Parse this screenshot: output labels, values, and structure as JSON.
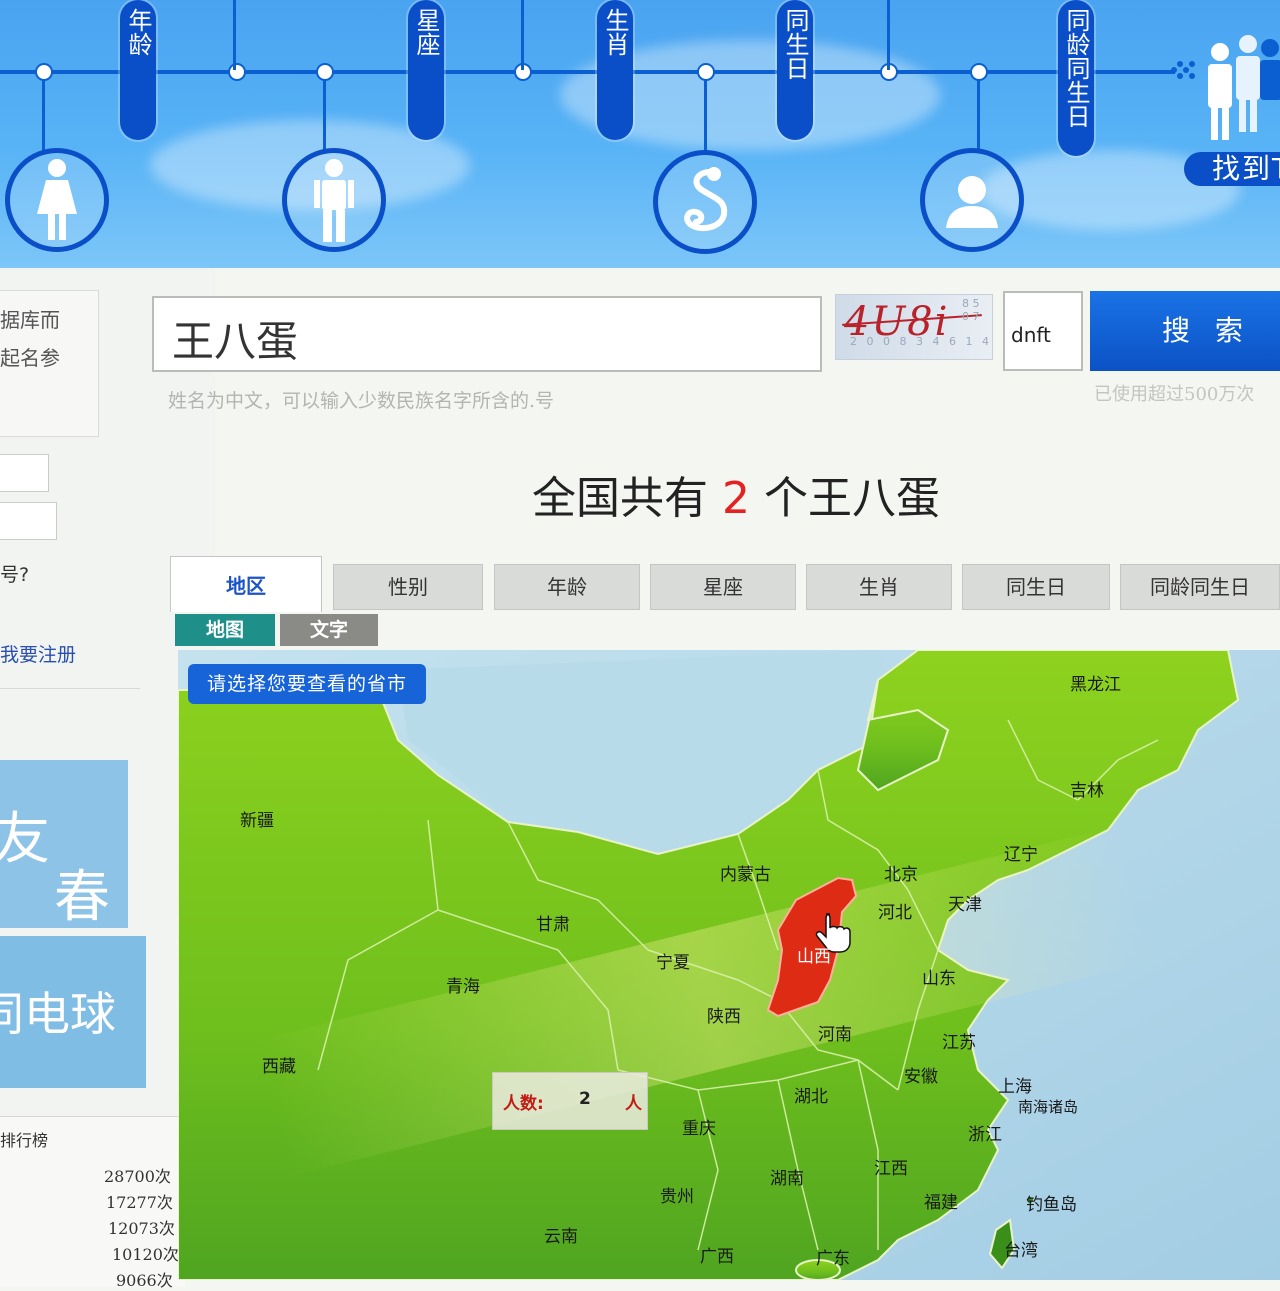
{
  "banner": {
    "pills": [
      "年龄",
      "星座",
      "生肖",
      "同生日",
      "同龄同生日"
    ],
    "find_button": "找到T"
  },
  "sidebar": {
    "text1": "据库而",
    "text2": "起名参",
    "forgot": "号?",
    "register": "我要注册",
    "promo1_line1": "友",
    "promo1_line2": "春",
    "promo2": "同电球",
    "rank_title": "排行榜",
    "rank_items": [
      "28700次",
      "17277次",
      "12073次",
      "10120次",
      "9066次"
    ]
  },
  "search": {
    "value": "王八蛋",
    "captcha_code": "4U8i",
    "captcha_noise": "2 0 0 8 3 4 6 1 4",
    "captcha_side": "8 5 0 7",
    "captcha_input": "dnft",
    "button": "搜 索",
    "hint": "姓名为中文，可以输入少数民族名字所含的.号",
    "usage": "已使用超过500万次"
  },
  "result": {
    "prefix": "全国共有",
    "count": "2",
    "suffix": "个王八蛋"
  },
  "tabs": [
    "地区",
    "性别",
    "年龄",
    "星座",
    "生肖",
    "同生日",
    "同龄同生日"
  ],
  "subtabs": [
    "地图",
    "文字"
  ],
  "map": {
    "hint": "请选择您要查看的省市",
    "highlighted": "山西",
    "count_label": "人数:",
    "count_value": "2",
    "count_unit": "人",
    "highlight_color": "#dd2b14",
    "land_color": "#7cc21e",
    "sea_color": "#a9cfe6",
    "provinces": [
      "黑龙江",
      "吉林",
      "辽宁",
      "新疆",
      "内蒙古",
      "北京",
      "天津",
      "河北",
      "甘肃",
      "宁夏",
      "山西",
      "山东",
      "青海",
      "陕西",
      "河南",
      "江苏",
      "西藏",
      "安徽",
      "湖北",
      "上海",
      "南海诸岛",
      "重庆",
      "浙江",
      "江西",
      "贵州",
      "湖南",
      "福建",
      "钓鱼岛",
      "云南",
      "广西",
      "广东",
      "台湾"
    ]
  }
}
